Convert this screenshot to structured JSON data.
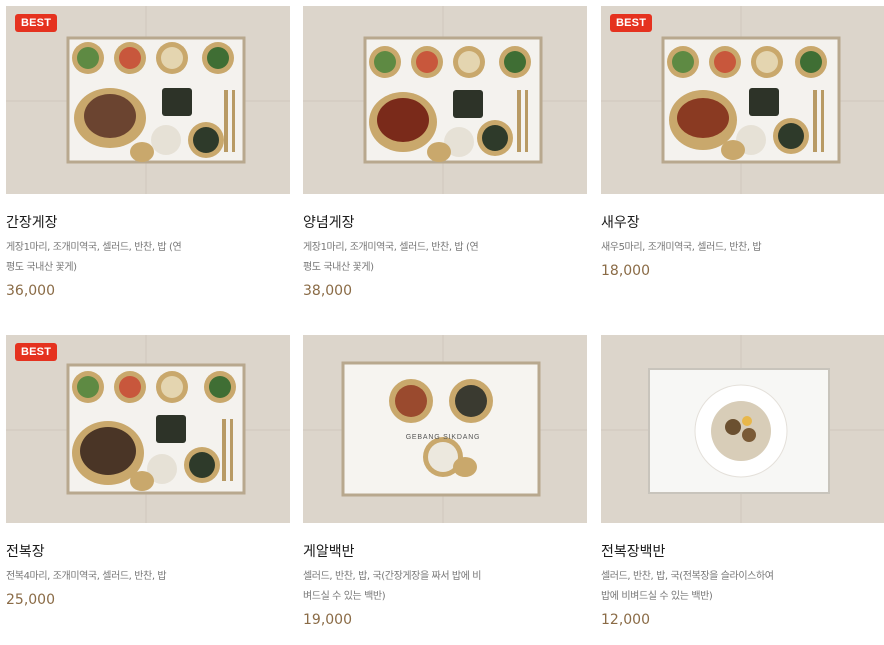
{
  "colors": {
    "badge": "#e5321f",
    "price": "#8a6b46",
    "description": "#777777",
    "title": "#1a1a1a"
  },
  "products": [
    {
      "name": "간장게장",
      "description": "게장1마리, 조개미역국, 셀러드, 반찬, 밥 (연평도 국내산 꽃게)",
      "price": "36,000",
      "badge": "BEST"
    },
    {
      "name": "양념게장",
      "description": "게장1마리, 조개미역국, 셀러드, 반찬, 밥 (연평도 국내산 꽃게)",
      "price": "38,000",
      "badge": ""
    },
    {
      "name": "새우장",
      "description": "새우5마리, 조개미역국, 셀러드, 반찬, 밥",
      "price": "18,000",
      "badge": "BEST"
    },
    {
      "name": "전복장",
      "description": "전복4마리, 조개미역국, 셀러드, 반찬, 밥",
      "price": "25,000",
      "badge": "BEST"
    },
    {
      "name": "게알백반",
      "description": "셀러드, 반찬, 밥, 국(간장게장을 짜서 밥에 비벼드실 수 있는 백반)",
      "price": "19,000",
      "badge": "",
      "tray_text": "GEBANG SIKDANG"
    },
    {
      "name": "전복장백반",
      "description": "셀러드, 반찬, 밥, 국(전복장을 슬라이스하여 밥에 비벼드실 수 있는 백반)",
      "price": "12,000",
      "badge": ""
    }
  ]
}
